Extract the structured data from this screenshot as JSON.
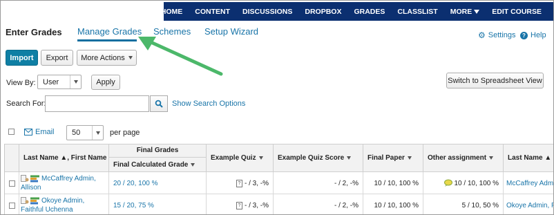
{
  "topnav": {
    "items": [
      "COURSE HOME",
      "CONTENT",
      "DISCUSSIONS",
      "DROPBOX",
      "GRADES",
      "CLASSLIST",
      "MORE",
      "EDIT COURSE"
    ],
    "accent": "#0b2f70"
  },
  "page": {
    "title": "Enter Grades"
  },
  "tabs": [
    "Manage Grades",
    "Schemes",
    "Setup Wizard"
  ],
  "utility": {
    "settings": "Settings",
    "help": "Help"
  },
  "toolbar": {
    "import": "Import",
    "export": "Export",
    "more_actions": "More Actions"
  },
  "viewby": {
    "label": "View By:",
    "value": "User",
    "apply": "Apply"
  },
  "switch_label": "Switch to Spreadsheet View",
  "search": {
    "label": "Search For:",
    "value": "",
    "options_link": "Show Search Options"
  },
  "list_controls": {
    "email": "Email",
    "per_page_value": "50",
    "per_page_label": "per page"
  },
  "table": {
    "headers": {
      "name": "Last Name ▲, First Name",
      "final_group": "Final Grades",
      "final_calc": "Final Calculated Grade",
      "example_quiz": "Example Quiz",
      "example_quiz_score": "Example Quiz Score",
      "final_paper": "Final Paper",
      "other_assignment": "Other assignment",
      "name_repeat": "Last Name ▲"
    },
    "rows": [
      {
        "name_line1": "McCaffrey Admin,",
        "name_line2": "Allison",
        "final_calc": "20 / 20, 100 %",
        "example_quiz": "- / 3, -%",
        "example_quiz_score": "- / 2, -%",
        "final_paper": "10 / 10, 100 %",
        "other_assignment": "10 / 10, 100 %",
        "name_repeat": "McCaffrey Admi"
      },
      {
        "name_line1": "Okoye Admin,",
        "name_line2": "Faithful Uchenna",
        "final_calc": "15 / 20, 75 %",
        "example_quiz": "- / 3, -%",
        "example_quiz_score": "- / 2, -%",
        "final_paper": "10 / 10, 100 %",
        "other_assignment": "5 / 10, 50 %",
        "name_repeat": "Okoye Admin, F"
      }
    ]
  },
  "annotation": {
    "arrow_color": "#4cb86a"
  },
  "icons": [
    "gear-icon",
    "help-icon",
    "search-icon",
    "email-icon",
    "chevron-down-icon",
    "user-profile-icon",
    "grade-bars-icon",
    "quiz-icon",
    "comment-icon"
  ]
}
